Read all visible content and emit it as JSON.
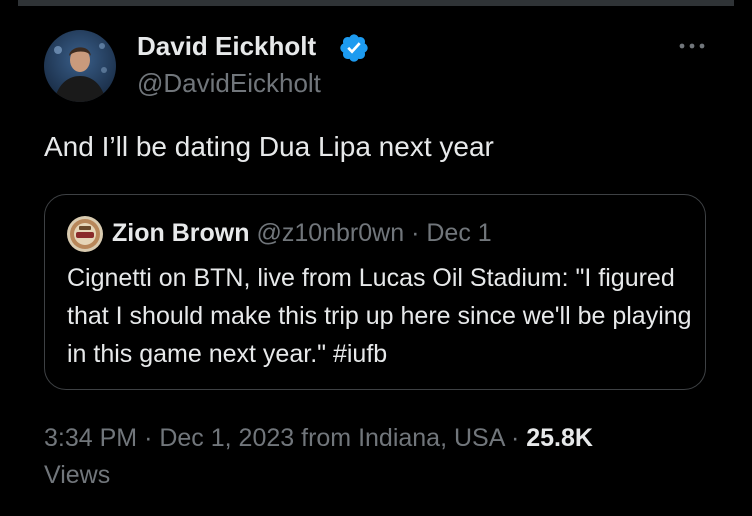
{
  "tweet": {
    "author": {
      "name": "David Eickholt",
      "handle": "@DavidEickholt",
      "verified": true
    },
    "text": "And I’ll be dating Dua Lipa next year",
    "quote": {
      "author_name": "Zion Brown",
      "author_handle": "@z10nbr0wn",
      "separator": "·",
      "date": "Dec 1",
      "text": "Cignetti on BTN, live from Lucas Oil Stadium: \"I figured that I should make this trip up here since we'll be playing in this game next year.\" #iufb"
    },
    "meta": {
      "time": "3:34 PM",
      "separator": "·",
      "date": "Dec 1, 2023",
      "location": "from Indiana, USA",
      "views_count": "25.8K",
      "views_label": "Views"
    }
  },
  "icons": {
    "verified": "verified-badge-icon",
    "more": "more-options-icon"
  },
  "colors": {
    "background": "#000000",
    "text_primary": "#e7e9ea",
    "text_secondary": "#71767b",
    "verified_blue": "#1d9bf0",
    "border": "#3e4144"
  }
}
